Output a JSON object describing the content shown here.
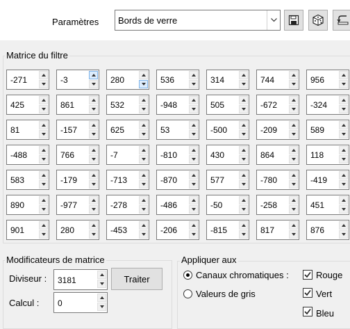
{
  "params": {
    "label": "Paramètres",
    "preset_value": "Bords de verre"
  },
  "icons": {
    "dropdown": "chevron-down-icon",
    "save": "save-icon",
    "random": "dice-icon",
    "reset": "reset-icon"
  },
  "matrix": {
    "title": "Matrice du filtre",
    "rows": [
      [
        "-271",
        "-3",
        "280",
        "536",
        "314",
        "744",
        "956"
      ],
      [
        "425",
        "861",
        "532",
        "-948",
        "505",
        "-672",
        "-324"
      ],
      [
        "81",
        "-157",
        "625",
        "53",
        "-500",
        "-209",
        "589"
      ],
      [
        "-488",
        "766",
        "-7",
        "-810",
        "430",
        "864",
        "118"
      ],
      [
        "583",
        "-179",
        "-713",
        "-870",
        "577",
        "-780",
        "-419"
      ],
      [
        "890",
        "-977",
        "-278",
        "-486",
        "-50",
        "-258",
        "451"
      ],
      [
        "901",
        "280",
        "-453",
        "-206",
        "-815",
        "817",
        "876"
      ]
    ]
  },
  "modifiers": {
    "title": "Modificateurs de matrice",
    "divisor_label": "Diviseur :",
    "divisor_value": "3181",
    "bias_label": "Calcul :",
    "bias_value": "0",
    "process_button": "Traiter"
  },
  "apply": {
    "title": "Appliquer aux",
    "color_channels": "Canaux chromatiques :",
    "grayscale": "Valeurs de gris",
    "color_channels_selected": true,
    "channels": [
      "Rouge",
      "Vert",
      "Bleu"
    ],
    "channels_checked": [
      true,
      true,
      true
    ]
  }
}
